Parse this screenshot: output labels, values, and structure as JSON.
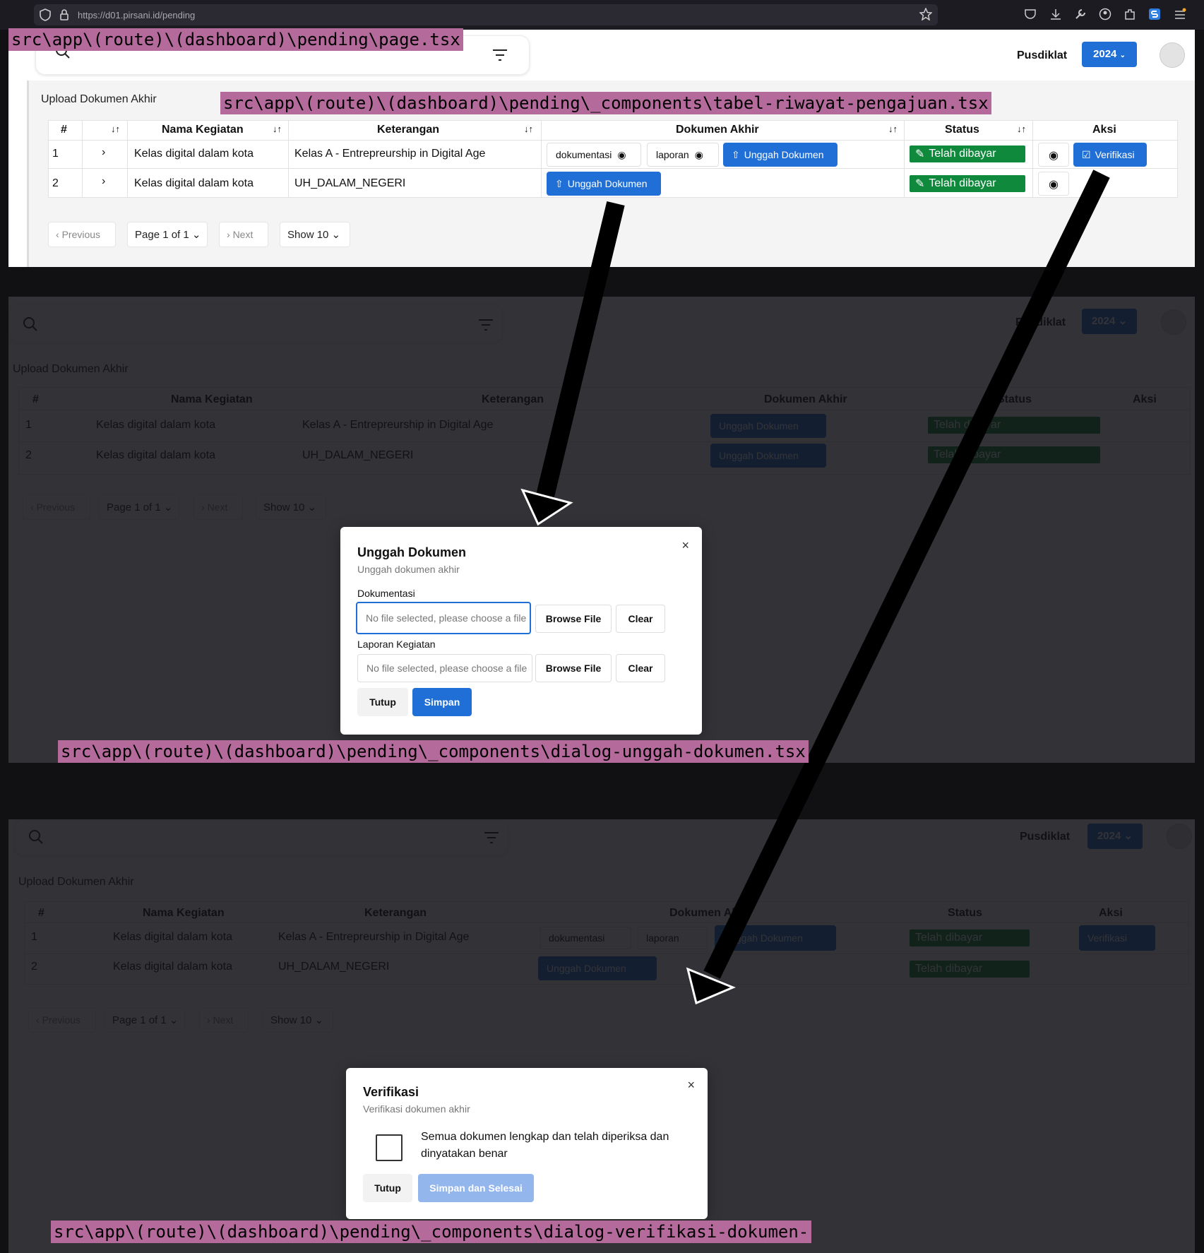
{
  "browser": {
    "url": "https://d01.pirsani.id/pending"
  },
  "file_labels": {
    "page": "src\\app\\(route)\\(dashboard)\\pending\\page.tsx",
    "table": "src\\app\\(route)\\(dashboard)\\pending\\_components\\tabel-riwayat-pengajuan.tsx",
    "dialog_unggah": "src\\app\\(route)\\(dashboard)\\pending\\_components\\dialog-unggah-dokumen.tsx",
    "dialog_verifikasi": "src\\app\\(route)\\(dashboard)\\pending\\_components\\dialog-verifikasi-dokumen-"
  },
  "header": {
    "org": "Pusdiklat",
    "year": "2024"
  },
  "section": {
    "title": "Upload Dokumen Akhir"
  },
  "table": {
    "columns": {
      "num": "#",
      "nama": "Nama Kegiatan",
      "keterangan": "Keterangan",
      "dokumen": "Dokumen Akhir",
      "status": "Status",
      "aksi": "Aksi"
    },
    "rows": [
      {
        "no": "1",
        "nama": "Kelas digital dalam kota",
        "keterangan": "Kelas A - Entrepreurship in Digital Age",
        "doc1": "dokumentasi",
        "doc2": "laporan",
        "upload": "Unggah Dokumen",
        "status": "Telah dibayar",
        "verify": "Verifikasi"
      },
      {
        "no": "2",
        "nama": "Kelas digital dalam kota",
        "keterangan": "UH_DALAM_NEGERI",
        "upload": "Unggah Dokumen",
        "status": "Telah dibayar"
      }
    ]
  },
  "pagination": {
    "previous": "Previous",
    "page": "Page 1 of 1",
    "next": "Next",
    "show": "Show 10"
  },
  "dialog_unggah": {
    "title": "Unggah Dokumen",
    "subtitle": "Unggah dokumen akhir",
    "field1_label": "Dokumentasi",
    "field2_label": "Laporan Kegiatan",
    "placeholder": "No file selected, please choose a file",
    "browse": "Browse File",
    "clear": "Clear",
    "close": "Tutup",
    "save": "Simpan"
  },
  "dialog_verifikasi": {
    "title": "Verifikasi",
    "subtitle": "Verifikasi dokumen akhir",
    "statement": "Semua dokumen lengkap dan telah diperiksa dan dinyatakan benar",
    "close": "Tutup",
    "save": "Simpan dan Selesai"
  },
  "colors": {
    "primary": "#1f6fd6",
    "paid": "#0f8a3c",
    "label_bg": "#b46b9c"
  }
}
